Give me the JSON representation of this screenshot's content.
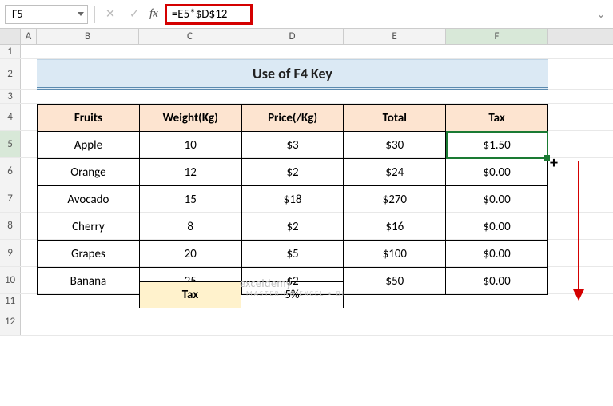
{
  "namebox": {
    "ref": "F5"
  },
  "formula_bar": {
    "formula": "=E5*$D$12",
    "fx_label": "fx"
  },
  "col_headers": [
    "A",
    "B",
    "C",
    "D",
    "E",
    "F"
  ],
  "row_headers": [
    "1",
    "2",
    "3",
    "4",
    "5",
    "6",
    "7",
    "8",
    "9",
    "10",
    "11",
    "12"
  ],
  "title": "Use of F4 Key",
  "table": {
    "headers": [
      "Fruits",
      "Weight(Kg)",
      "Price(/Kg)",
      "Total",
      "Tax"
    ],
    "rows": [
      {
        "fruit": "Apple",
        "weight": "10",
        "price": "$3",
        "total": "$30",
        "tax": "$1.50"
      },
      {
        "fruit": "Orange",
        "weight": "12",
        "price": "$2",
        "total": "$24",
        "tax": "$0.00"
      },
      {
        "fruit": "Avocado",
        "weight": "15",
        "price": "$18",
        "total": "$270",
        "tax": "$0.00"
      },
      {
        "fruit": "Cherry",
        "weight": "8",
        "price": "$2",
        "total": "$16",
        "tax": "$0.00"
      },
      {
        "fruit": "Grapes",
        "weight": "20",
        "price": "$5",
        "total": "$100",
        "tax": "$0.00"
      },
      {
        "fruit": "Banana",
        "weight": "25",
        "price": "$2",
        "total": "$50",
        "tax": "$0.00"
      }
    ]
  },
  "tax_box": {
    "label": "Tax",
    "value": "5%"
  },
  "watermark": {
    "brand": "exceldemy",
    "sub": "MASTERING EXCEL • BI"
  },
  "active_col": "F",
  "active_row": "5",
  "fill_cursor_glyph": "+",
  "expand_glyph": "⌄"
}
